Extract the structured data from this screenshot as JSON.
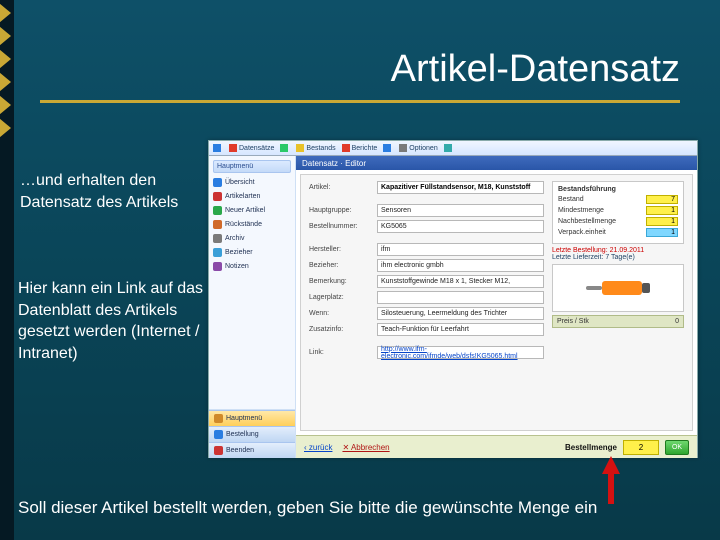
{
  "slide": {
    "title": "Artikel-Datensatz",
    "caption1": "…und erhalten den Datensatz des Artikels",
    "caption2": "Hier kann ein Link auf das Datenblatt des Artikels gesetzt werden (Internet / Intranet)",
    "caption3": "Soll dieser Artikel bestellt werden, geben Sie bitte die gewünschte Menge ein"
  },
  "toolbar": {
    "items": [
      {
        "icon": "#2a7de1",
        "label": ""
      },
      {
        "icon": "#e13b2a",
        "label": "Datensätze"
      },
      {
        "icon": "#2ac96a",
        "label": ""
      },
      {
        "icon": "#e8c22a",
        "label": "Bestands"
      },
      {
        "icon": "#e13b2a",
        "label": "Berichte"
      },
      {
        "icon": "#2a7de1",
        "label": ""
      },
      {
        "icon": "#7a7a7a",
        "label": "Optionen"
      },
      {
        "icon": "#3aa",
        "label": ""
      }
    ]
  },
  "sidebar": {
    "title": "Hauptmenü",
    "items": [
      {
        "icon": "#2a7de1",
        "label": "Übersicht"
      },
      {
        "icon": "#cc3333",
        "label": "Artikelarten"
      },
      {
        "icon": "#2aa84a",
        "label": "Neuer Artikel"
      },
      {
        "icon": "#d06a2a",
        "label": "Rückstände"
      },
      {
        "icon": "#7a7a7a",
        "label": "Archiv"
      },
      {
        "icon": "#3a9fd8",
        "label": "Bezieher"
      },
      {
        "icon": "#8a4aa8",
        "label": "Notizen"
      }
    ],
    "buttons": [
      {
        "label": "Hauptmenü",
        "active": true
      },
      {
        "label": "Bestellung",
        "active": false
      },
      {
        "label": "Beenden",
        "active": false
      }
    ]
  },
  "editor": {
    "header": "Datensatz · Editor",
    "fields": {
      "artikel_label": "Artikel:",
      "artikel_value": "Kapazitiver Füllstandsensor, M18, Kunststoff",
      "hauptgruppe_label": "Hauptgruppe:",
      "hauptgruppe_value": "Sensoren",
      "bestellnr_label": "Bestellnummer:",
      "bestellnr_value": "KG5065",
      "hersteller_label": "Hersteller:",
      "hersteller_value": "ifm",
      "bezieher_label": "Bezieher:",
      "bezieher_value": "ihm electronic gmbh",
      "bemerkung_label": "Bemerkung:",
      "bemerkung_value": "Kunststoffgewinde M18 x 1, Stecker M12,",
      "lagerplatz_label": "Lagerplatz:",
      "lagerplatz_value": "",
      "wenn_label": "Wenn:",
      "wenn_value": "Silosteuerung, Leermeldung des Trichter",
      "zusatz_label": "Zusatzinfo:",
      "zusatz_value": "Teach-Funktion für Leerfahrt",
      "link_label": "Link:",
      "link_value": "http://www.ifm-electronic.com/ifmde/web/dsfs!KG5065.html"
    },
    "right": {
      "box_title": "Bestandsführung",
      "bestand_label": "Bestand",
      "bestand_value": "7",
      "mindest_label": "Mindestmenge",
      "mindest_value": "1",
      "nachbest_label": "Nachbestellmenge",
      "nachbest_value": "1",
      "verpack_label": "Verpack.einheit",
      "verpack_value": "1",
      "note_best_label": "Letzte Bestellung:",
      "note_best_value": "21.09.2011",
      "note_lief_label": "Letzte Lieferzeit:",
      "note_lief_value": "7 Tage(e)",
      "preis_label": "Preis / Stk",
      "preis_value": "0"
    },
    "footer": {
      "back": "‹ zurück",
      "cancel": "✕ Abbrechen",
      "qty_label": "Bestellmenge",
      "qty_value": "2",
      "ok": "OK"
    }
  }
}
